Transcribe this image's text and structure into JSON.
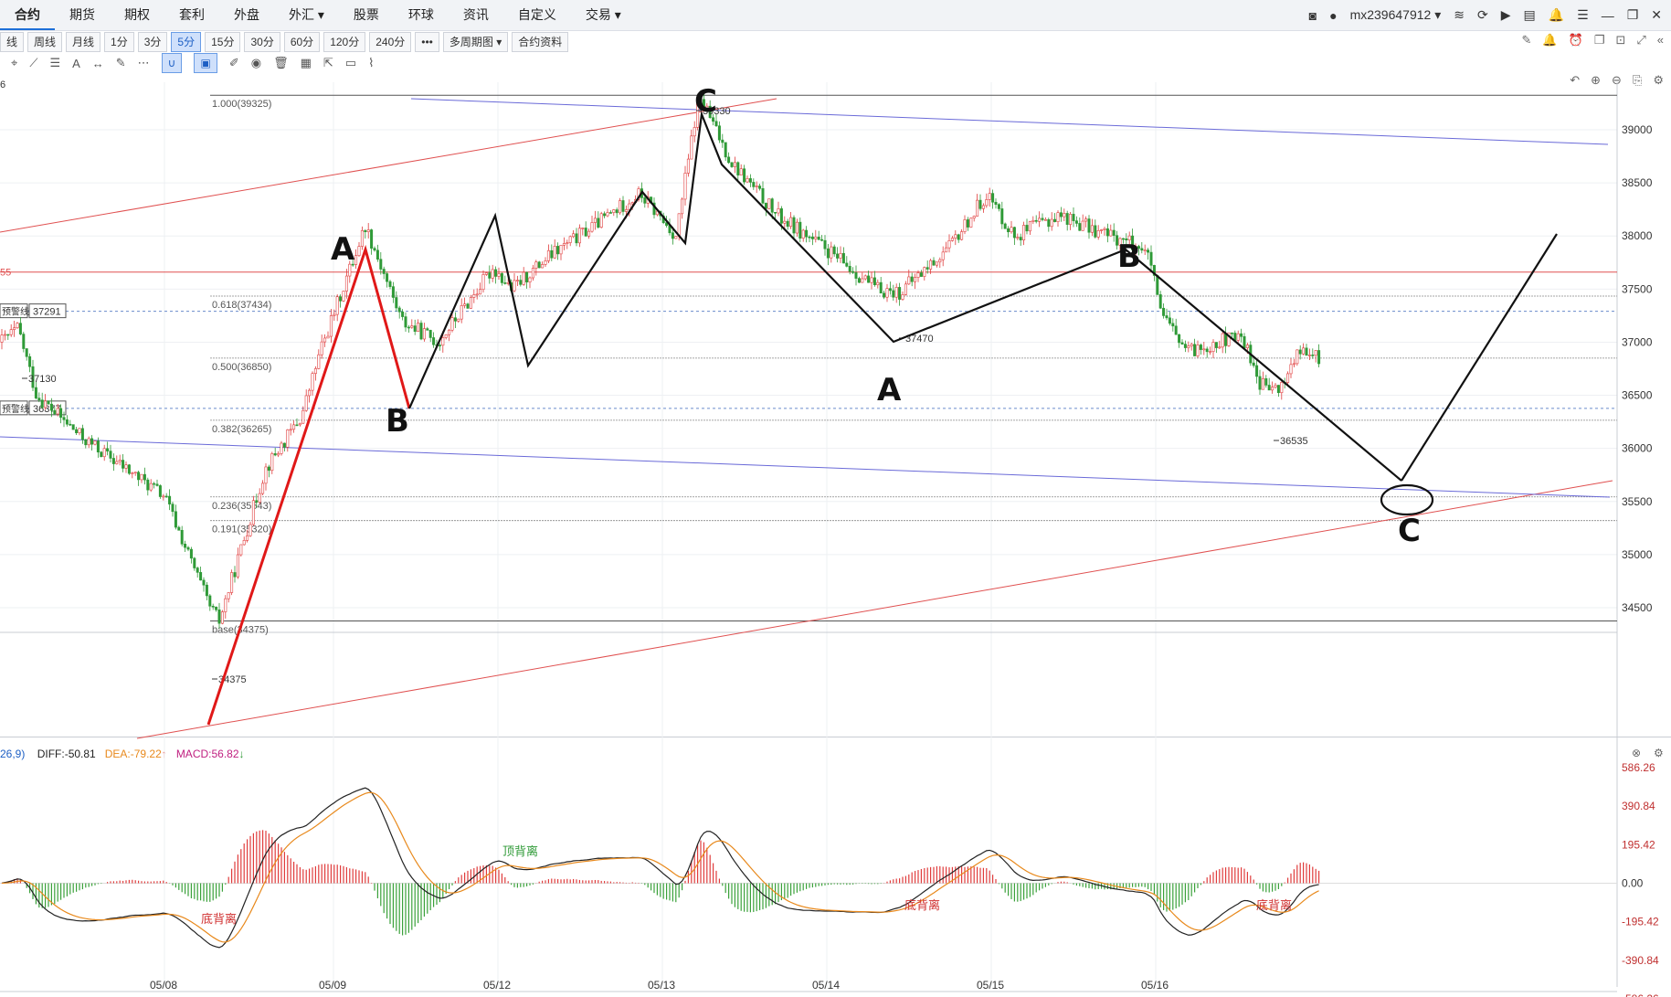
{
  "nav": {
    "items": [
      "合约",
      "期货",
      "期权",
      "套利",
      "外盘",
      "外汇",
      "股票",
      "环球",
      "资讯",
      "自定义",
      "交易"
    ],
    "active": "合约",
    "user": "mx239647912"
  },
  "toolbar": {
    "periods": [
      "线",
      "周线",
      "月线",
      "1分",
      "3分",
      "5分",
      "15分",
      "30分",
      "60分",
      "120分",
      "240分",
      "•••"
    ],
    "active_period": "5分",
    "multi_period": "多周期图",
    "contract_info": "合约资料"
  },
  "top_left_clip": "6",
  "left_tags": {
    "red_line_clip": "55",
    "alert1_text": "预警线",
    "alert1_value": "37291",
    "alert2_text": "预警线",
    "alert2_value": "36377"
  },
  "price_axis": [
    "39000",
    "38500",
    "38000",
    "37500",
    "37000",
    "36500",
    "36000",
    "35500",
    "35000",
    "34500"
  ],
  "date_axis": [
    "05/08",
    "05/09",
    "05/12",
    "05/13",
    "05/14",
    "05/15",
    "05/16"
  ],
  "fib_levels": [
    {
      "label": "1.000(39325)",
      "price": 39325
    },
    {
      "label": "0.618(37434)",
      "price": 37434
    },
    {
      "label": "0.500(36850)",
      "price": 36850
    },
    {
      "label": "0.382(36265)",
      "price": 36265
    },
    {
      "label": "0.236(35543)",
      "price": 35543
    },
    {
      "label": "0.191(35320)",
      "price": 35320
    },
    {
      "label": "base(34375)",
      "price": 34375
    }
  ],
  "price_marks": [
    {
      "label": "39330",
      "price": 39330
    },
    {
      "label": "37470",
      "price": 37470
    },
    {
      "label": "37130",
      "price": 37130
    },
    {
      "label": "36535",
      "price": 36535
    },
    {
      "label": "34375",
      "price": 34375
    }
  ],
  "horizontal_red_price": 37660,
  "annotations": {
    "A1": "A",
    "B1": "B",
    "C": "C",
    "A2": "A",
    "B2": "B",
    "C2": "C"
  },
  "macd": {
    "params_clip": "26,9)",
    "diff_label": "DIFF:-50.81",
    "dea_label": "DEA:-79.22",
    "macd_label": "MACD:56.82",
    "axis": [
      "586.26",
      "390.84",
      "195.42",
      "0.00",
      "-195.42",
      "-390.84",
      "-586.26"
    ],
    "divergence_labels": [
      "顶背离",
      "底背离",
      "底背离",
      "底背离"
    ],
    "colors": {
      "diff": "#222222",
      "dea": "#e8891c",
      "up": "#e03c3c",
      "down": "#3aa13a"
    }
  },
  "colors": {
    "up": "#e03c3c",
    "down": "#2f9a37",
    "accent": "#1d6fd8",
    "trend_red": "#e05050",
    "trend_blue": "#6a6ad8"
  },
  "chart_data": {
    "type": "candlestick",
    "xlabel": "",
    "ylabel": "",
    "ylim": [
      34300,
      39400
    ],
    "x_ticks": [
      "05/08",
      "05/09",
      "05/12",
      "05/13",
      "05/14",
      "05/15",
      "05/16"
    ],
    "y_ticks": [
      34500,
      35000,
      35500,
      36000,
      36500,
      37000,
      37500,
      38000,
      38500,
      39000
    ],
    "path_points": [
      {
        "date": "05/07",
        "price": 37130
      },
      {
        "date": "05/08",
        "price": 36400
      },
      {
        "date": "05/08",
        "price": 34375
      },
      {
        "date": "05/09",
        "price": 38200
      },
      {
        "date": "05/09",
        "price": 36850
      },
      {
        "date": "05/12",
        "price": 38400
      },
      {
        "date": "05/12",
        "price": 37300
      },
      {
        "date": "05/13",
        "price": 39330
      },
      {
        "date": "05/14",
        "price": 37470
      },
      {
        "date": "05/15",
        "price": 38200
      },
      {
        "date": "05/16",
        "price": 36900
      },
      {
        "date": "05/16",
        "price": 36535
      },
      {
        "date": "05/16",
        "price": 36850
      }
    ],
    "macd_range": [
      -586.26,
      586.26
    ],
    "last": {
      "DIFF": -50.81,
      "DEA": -79.22,
      "MACD": 56.82
    }
  }
}
